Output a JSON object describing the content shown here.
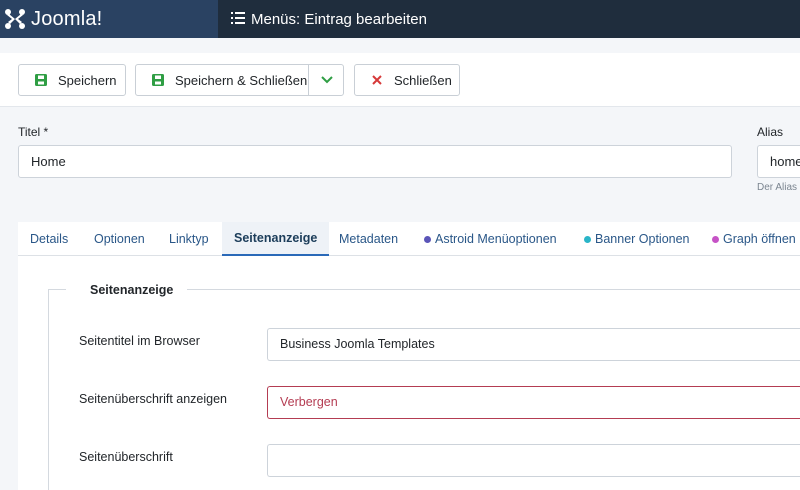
{
  "header": {
    "brand": "Joomla!",
    "page_title": "Menüs: Eintrag bearbeiten"
  },
  "toolbar": {
    "save_label": "Speichern",
    "save_close_label": "Speichern & Schließen",
    "close_label": "Schließen"
  },
  "colors": {
    "header_bg": "#1f2d3d",
    "brand_bg": "#2a4262",
    "save_icon": "#2f9e44",
    "close_icon": "#d63939",
    "tab_link": "#2a5788",
    "invalid": "#b43c52"
  },
  "form": {
    "title_label": "Titel *",
    "title_value": "Home",
    "alias_label": "Alias",
    "alias_value": "home",
    "alias_hint": "Der Alias"
  },
  "tabs": [
    {
      "label": "Details"
    },
    {
      "label": "Optionen"
    },
    {
      "label": "Linktyp"
    },
    {
      "label": "Seitenanzeige",
      "active": true
    },
    {
      "label": "Metadaten"
    },
    {
      "label": "Astroid Menüoptionen",
      "dot": "#5b55b8"
    },
    {
      "label": "Banner Optionen",
      "dot": "#2ab5c8"
    },
    {
      "label": "Graph öffnen",
      "dot": "#c653c6"
    }
  ],
  "panel": {
    "legend": "Seitenanzeige",
    "fields": [
      {
        "label": "Seitentitel im Browser",
        "value": "Business Joomla Templates"
      },
      {
        "label": "Seitenüberschrift anzeigen",
        "value": "Verbergen"
      },
      {
        "label": "Seitenüberschrift",
        "value": ""
      }
    ]
  },
  "icons": {
    "menu": "list-icon",
    "save": "save-icon",
    "caret": "chevron-down-icon",
    "close": "close-icon"
  }
}
